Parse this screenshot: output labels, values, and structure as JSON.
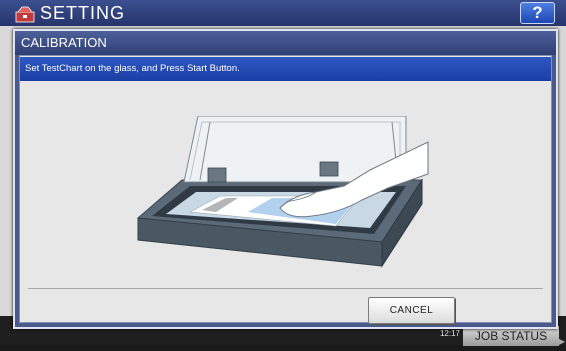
{
  "background_screen": {
    "title": "SETTING",
    "help_label": "?",
    "date": "",
    "time": "12:17",
    "job_status_label": "JOB STATUS"
  },
  "dialog": {
    "title": "CALIBRATION",
    "message": "Set TestChart on the glass, and Press Start Button.",
    "cancel_label": "CANCEL"
  },
  "icons": {
    "logo": "setting-toolbox-icon",
    "illustration": "scanner-glass-with-hand-placing-chart"
  },
  "colors": {
    "header_blue": "#2e3f74",
    "message_blue": "#1a3ea3",
    "help_blue": "#1d47b5"
  }
}
